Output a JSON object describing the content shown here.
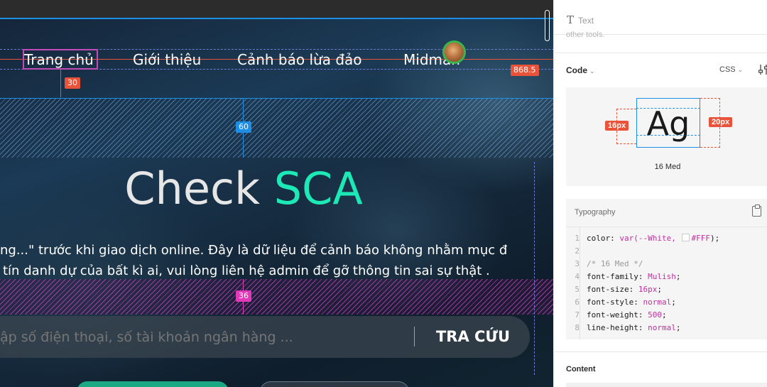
{
  "canvas": {
    "nav": {
      "home": "Trang chủ",
      "about": "Giới thiệu",
      "warnings": "Cảnh báo lừa đảo",
      "middleman": "Midman"
    },
    "measurements": {
      "nav_gap": "30",
      "nav_width": "868.5",
      "padding_top": "60",
      "padding_bottom": "36"
    },
    "hero": {
      "title_part1": "Check ",
      "title_part2": "SCA",
      "accent_color": "#1de9b6",
      "description_line1": "ng...\" trước khi giao dịch online. Đây là dữ liệu để cảnh báo không nhằm mục đ",
      "description_line2": "tín danh dự của bất kì ai, vui lòng liên hệ admin để gỡ thông tin sai sự thật ."
    },
    "search": {
      "placeholder": "ập số điện thoại, số tài khoản ngân hàng ...",
      "button_label": "TRA CỨU"
    }
  },
  "inspector": {
    "layer_type_label": "Text",
    "faded_text": "other tools.",
    "code_label": "Code",
    "language_select": "CSS",
    "preview": {
      "sample": "Ag",
      "left_padding": "16px",
      "right_padding": "20px",
      "style_name": "16 Med"
    },
    "typography_label": "Typography",
    "code_lines": [
      {
        "n": "1",
        "prop": "color",
        "val": "var(--White, ",
        "swatch": "#FFF",
        "val_end": "#FFF",
        "tail": ");"
      },
      {
        "n": "2"
      },
      {
        "n": "3",
        "comment": "/* 16 Med */"
      },
      {
        "n": "4",
        "prop": "font-family",
        "val": "Mulish"
      },
      {
        "n": "5",
        "prop": "font-size",
        "val": "16px"
      },
      {
        "n": "6",
        "prop": "font-style",
        "val": "normal"
      },
      {
        "n": "7",
        "prop": "font-weight",
        "val": "500"
      },
      {
        "n": "8",
        "prop": "line-height",
        "val": "normal"
      }
    ],
    "content_label": "Content"
  }
}
